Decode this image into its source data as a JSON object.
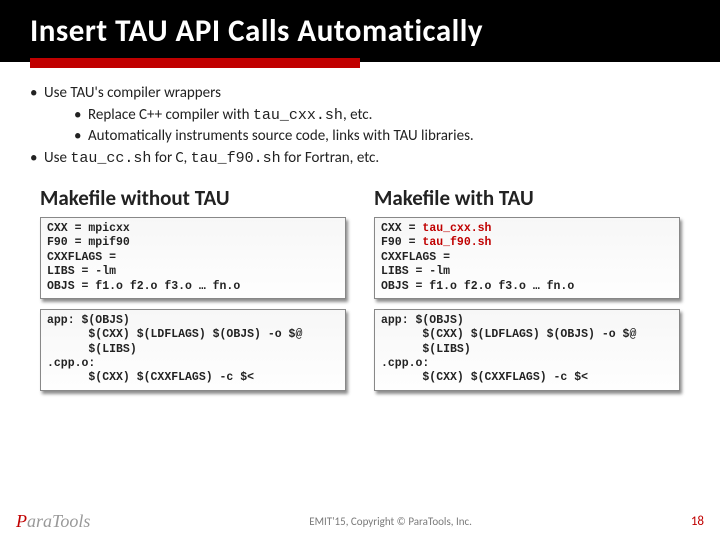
{
  "title": "Insert TAU API Calls Automatically",
  "bullets": {
    "b1": "Use TAU's compiler wrappers",
    "b1a_pre": "Replace C++ compiler with ",
    "b1a_code": "tau_cxx.sh",
    "b1a_post": ", etc.",
    "b1b": "Automatically instruments source code, links with TAU libraries.",
    "b2_pre": "Use ",
    "b2_code1": "tau_cc.sh",
    "b2_mid": " for C, ",
    "b2_code2": "tau_f90.sh",
    "b2_post": " for Fortran, etc."
  },
  "left": {
    "heading": "Makefile without TAU",
    "box1": "CXX = mpicxx\nF90 = mpif90\nCXXFLAGS =\nLIBS = -lm\nOBJS = f1.o f2.o f3.o … fn.o",
    "box2": "app: $(OBJS)\n      $(CXX) $(LDFLAGS) $(OBJS) -o $@ \n      $(LIBS)\n.cpp.o:\n      $(CXX) $(CXXFLAGS) -c $<"
  },
  "right": {
    "heading": "Makefile with TAU",
    "r1a": "CXX = ",
    "r1b": "tau_cxx.sh",
    "r2a": "F90 = ",
    "r2b": "tau_f90.sh",
    "r_rest": "CXXFLAGS =\nLIBS = -lm\nOBJS = f1.o f2.o f3.o … fn.o",
    "box2": "app: $(OBJS)\n      $(CXX) $(LDFLAGS) $(OBJS) -o $@ \n      $(LIBS)\n.cpp.o:\n      $(CXX) $(CXXFLAGS) -c $<"
  },
  "footer": {
    "logo_p": "P",
    "logo_rest": "araTools",
    "center": "EMIT'15, Copyright © ParaTools, Inc.",
    "page": "18"
  }
}
